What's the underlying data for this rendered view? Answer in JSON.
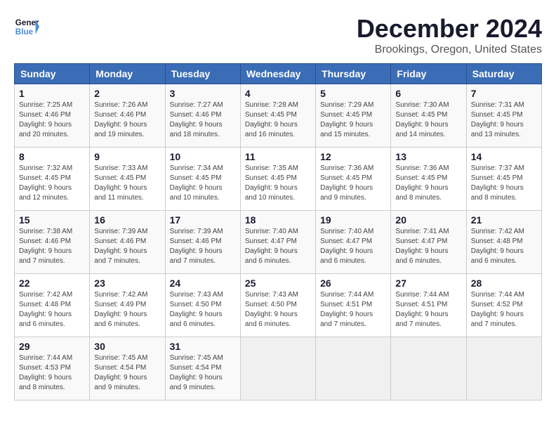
{
  "header": {
    "logo_text_general": "General",
    "logo_text_blue": "Blue",
    "title": "December 2024",
    "subtitle": "Brookings, Oregon, United States"
  },
  "calendar": {
    "days_of_week": [
      "Sunday",
      "Monday",
      "Tuesday",
      "Wednesday",
      "Thursday",
      "Friday",
      "Saturday"
    ],
    "weeks": [
      [
        {
          "day": "1",
          "sunrise": "7:25 AM",
          "sunset": "4:46 PM",
          "daylight": "9 hours and 20 minutes."
        },
        {
          "day": "2",
          "sunrise": "7:26 AM",
          "sunset": "4:46 PM",
          "daylight": "9 hours and 19 minutes."
        },
        {
          "day": "3",
          "sunrise": "7:27 AM",
          "sunset": "4:46 PM",
          "daylight": "9 hours and 18 minutes."
        },
        {
          "day": "4",
          "sunrise": "7:28 AM",
          "sunset": "4:45 PM",
          "daylight": "9 hours and 16 minutes."
        },
        {
          "day": "5",
          "sunrise": "7:29 AM",
          "sunset": "4:45 PM",
          "daylight": "9 hours and 15 minutes."
        },
        {
          "day": "6",
          "sunrise": "7:30 AM",
          "sunset": "4:45 PM",
          "daylight": "9 hours and 14 minutes."
        },
        {
          "day": "7",
          "sunrise": "7:31 AM",
          "sunset": "4:45 PM",
          "daylight": "9 hours and 13 minutes."
        }
      ],
      [
        {
          "day": "8",
          "sunrise": "7:32 AM",
          "sunset": "4:45 PM",
          "daylight": "9 hours and 12 minutes."
        },
        {
          "day": "9",
          "sunrise": "7:33 AM",
          "sunset": "4:45 PM",
          "daylight": "9 hours and 11 minutes."
        },
        {
          "day": "10",
          "sunrise": "7:34 AM",
          "sunset": "4:45 PM",
          "daylight": "9 hours and 10 minutes."
        },
        {
          "day": "11",
          "sunrise": "7:35 AM",
          "sunset": "4:45 PM",
          "daylight": "9 hours and 10 minutes."
        },
        {
          "day": "12",
          "sunrise": "7:36 AM",
          "sunset": "4:45 PM",
          "daylight": "9 hours and 9 minutes."
        },
        {
          "day": "13",
          "sunrise": "7:36 AM",
          "sunset": "4:45 PM",
          "daylight": "9 hours and 8 minutes."
        },
        {
          "day": "14",
          "sunrise": "7:37 AM",
          "sunset": "4:45 PM",
          "daylight": "9 hours and 8 minutes."
        }
      ],
      [
        {
          "day": "15",
          "sunrise": "7:38 AM",
          "sunset": "4:46 PM",
          "daylight": "9 hours and 7 minutes."
        },
        {
          "day": "16",
          "sunrise": "7:39 AM",
          "sunset": "4:46 PM",
          "daylight": "9 hours and 7 minutes."
        },
        {
          "day": "17",
          "sunrise": "7:39 AM",
          "sunset": "4:46 PM",
          "daylight": "9 hours and 7 minutes."
        },
        {
          "day": "18",
          "sunrise": "7:40 AM",
          "sunset": "4:47 PM",
          "daylight": "9 hours and 6 minutes."
        },
        {
          "day": "19",
          "sunrise": "7:40 AM",
          "sunset": "4:47 PM",
          "daylight": "9 hours and 6 minutes."
        },
        {
          "day": "20",
          "sunrise": "7:41 AM",
          "sunset": "4:47 PM",
          "daylight": "9 hours and 6 minutes."
        },
        {
          "day": "21",
          "sunrise": "7:42 AM",
          "sunset": "4:48 PM",
          "daylight": "9 hours and 6 minutes."
        }
      ],
      [
        {
          "day": "22",
          "sunrise": "7:42 AM",
          "sunset": "4:48 PM",
          "daylight": "9 hours and 6 minutes."
        },
        {
          "day": "23",
          "sunrise": "7:42 AM",
          "sunset": "4:49 PM",
          "daylight": "9 hours and 6 minutes."
        },
        {
          "day": "24",
          "sunrise": "7:43 AM",
          "sunset": "4:50 PM",
          "daylight": "9 hours and 6 minutes."
        },
        {
          "day": "25",
          "sunrise": "7:43 AM",
          "sunset": "4:50 PM",
          "daylight": "9 hours and 6 minutes."
        },
        {
          "day": "26",
          "sunrise": "7:44 AM",
          "sunset": "4:51 PM",
          "daylight": "9 hours and 7 minutes."
        },
        {
          "day": "27",
          "sunrise": "7:44 AM",
          "sunset": "4:51 PM",
          "daylight": "9 hours and 7 minutes."
        },
        {
          "day": "28",
          "sunrise": "7:44 AM",
          "sunset": "4:52 PM",
          "daylight": "9 hours and 7 minutes."
        }
      ],
      [
        {
          "day": "29",
          "sunrise": "7:44 AM",
          "sunset": "4:53 PM",
          "daylight": "9 hours and 8 minutes."
        },
        {
          "day": "30",
          "sunrise": "7:45 AM",
          "sunset": "4:54 PM",
          "daylight": "9 hours and 9 minutes."
        },
        {
          "day": "31",
          "sunrise": "7:45 AM",
          "sunset": "4:54 PM",
          "daylight": "9 hours and 9 minutes."
        },
        null,
        null,
        null,
        null
      ]
    ]
  }
}
